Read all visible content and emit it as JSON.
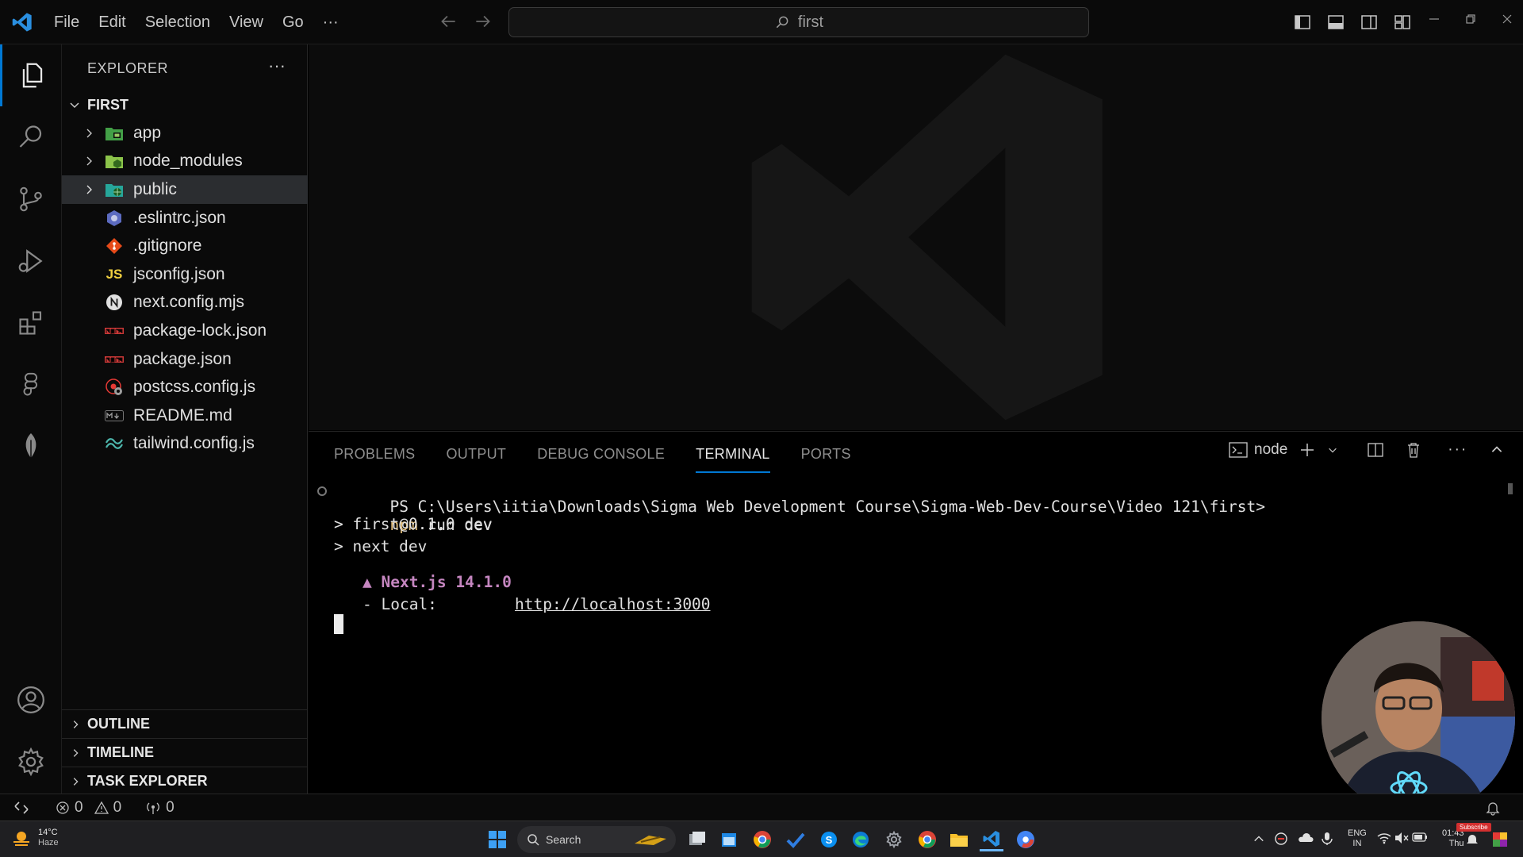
{
  "titlebar": {
    "menu": [
      "File",
      "Edit",
      "Selection",
      "View",
      "Go",
      "···"
    ],
    "search_text": "first",
    "icons": [
      "vscode-logo",
      "back-arrow-icon",
      "forward-arrow-icon",
      "search-icon",
      "toggle-sidebar-icon",
      "toggle-panel-icon",
      "toggle-secondary-sidebar-icon",
      "customize-layout-icon",
      "minimize-icon",
      "restore-icon",
      "close-icon"
    ]
  },
  "activity_bar": {
    "items": [
      "explorer-icon",
      "search-icon",
      "source-control-icon",
      "run-debug-icon",
      "extensions-icon",
      "figma-icon",
      "mongodb-leaf-icon",
      "accounts-icon",
      "manage-gear-icon"
    ]
  },
  "sidebar": {
    "title": "EXPLORER",
    "more": "···",
    "folder": "FIRST",
    "tree": [
      {
        "name": "app",
        "type": "folder",
        "icon": "app-folder-icon"
      },
      {
        "name": "node_modules",
        "type": "folder",
        "icon": "node-modules-folder-icon"
      },
      {
        "name": "public",
        "type": "folder",
        "icon": "public-folder-icon",
        "selected": true
      },
      {
        "name": ".eslintrc.json",
        "type": "file",
        "icon": "eslint-icon"
      },
      {
        "name": ".gitignore",
        "type": "file",
        "icon": "git-icon"
      },
      {
        "name": "jsconfig.json",
        "type": "file",
        "icon": "js-icon"
      },
      {
        "name": "next.config.mjs",
        "type": "file",
        "icon": "nextjs-icon"
      },
      {
        "name": "package-lock.json",
        "type": "file",
        "icon": "npm-icon"
      },
      {
        "name": "package.json",
        "type": "file",
        "icon": "npm-icon"
      },
      {
        "name": "postcss.config.js",
        "type": "file",
        "icon": "postcss-icon"
      },
      {
        "name": "README.md",
        "type": "file",
        "icon": "markdown-icon"
      },
      {
        "name": "tailwind.config.js",
        "type": "file",
        "icon": "tailwind-icon"
      }
    ],
    "sections": [
      "OUTLINE",
      "TIMELINE",
      "TASK EXPLORER"
    ]
  },
  "panel": {
    "tabs": [
      "PROBLEMS",
      "OUTPUT",
      "DEBUG CONSOLE",
      "TERMINAL",
      "PORTS"
    ],
    "active_tab": "TERMINAL",
    "terminal_name": "node",
    "terminal": {
      "prompt": "PS C:\\Users\\iitia\\Downloads\\Sigma Web Development Course\\Sigma-Web-Dev-Course\\Video 121\\first>",
      "command_exec": "npm",
      "command_args": " run dev",
      "line1": "> first@0.1.0 dev",
      "line2": "> next dev",
      "next_banner": "▲ Next.js 14.1.0",
      "local_label": "- Local:",
      "local_url": "http://localhost:3000"
    }
  },
  "statusbar": {
    "errors": "0",
    "warnings": "0",
    "ports": "0"
  },
  "taskbar": {
    "weather_temp": "14°C",
    "weather_desc": "Haze",
    "search_label": "Search",
    "lang_top": "ENG",
    "lang_bottom": "IN",
    "clock_time": "01:43",
    "clock_day": "Thu",
    "subscribe": "Subscribe"
  },
  "colors": {
    "accent": "#0078d4",
    "next_banner": "#c586c0",
    "npm_exec": "#e5c07b"
  }
}
